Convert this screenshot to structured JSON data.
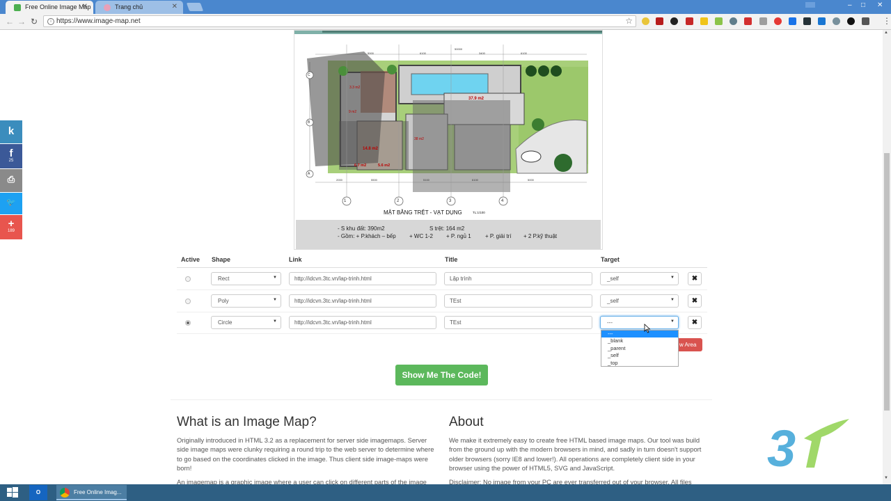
{
  "browser": {
    "tabs": [
      {
        "label": "Free Online Image Map",
        "active": true
      },
      {
        "label": "Trang chủ",
        "active": false
      }
    ],
    "url": "https://www.image-map.net",
    "window_controls": [
      "‒",
      "□",
      "✕"
    ]
  },
  "social": [
    {
      "icon": "k-icon",
      "glyph": "k",
      "count": "",
      "color": "#3b8dbd"
    },
    {
      "icon": "facebook-icon",
      "glyph": "f",
      "count": "25",
      "color": "#3b5998"
    },
    {
      "icon": "print-icon",
      "glyph": "⎙",
      "count": "",
      "color": "#8a8a8a"
    },
    {
      "icon": "twitter-icon",
      "glyph": "🐦",
      "count": "",
      "color": "#1da1f2"
    },
    {
      "icon": "plus-icon",
      "glyph": "+",
      "count": "189",
      "color": "#e8554e"
    }
  ],
  "plan": {
    "title": "MẶT BẰNG TRỆT - VẠT DỤNG",
    "scale": "TL:1/100",
    "notes": [
      "- S khu đất: 390m2",
      "S trệt: 164 m2",
      "- Gồm: + P.khách – bếp",
      "+ WC 1-2",
      "+ P. ngủ 1",
      "+ P. giải trí",
      "+ 2 P.kỹ thuật"
    ],
    "room_labels": [
      "37.9 m2",
      "14.8 m2",
      "6.7 m2",
      "5.6 m2",
      "38 m2",
      "3.3 m2",
      "9 m2"
    ],
    "axis_labels": [
      "1",
      "2",
      "3",
      "4",
      "A",
      "B",
      "C"
    ],
    "dims_top": [
      "5000",
      "6100",
      "50000",
      "3400",
      "6100"
    ],
    "dims_bottom": [
      "2000",
      "5500",
      "5100",
      "6100",
      "5000"
    ]
  },
  "table": {
    "headers": {
      "active": "Active",
      "shape": "Shape",
      "link": "Link",
      "title": "Title",
      "target": "Target"
    },
    "rows": [
      {
        "active": false,
        "shape": "Rect",
        "link": "http://idcvn.3tc.vn/lap-trinh.html",
        "title": "Lập trình",
        "target": "_self"
      },
      {
        "active": false,
        "shape": "Poly",
        "link": "http://idcvn.3tc.vn/lap-trinh.html",
        "title": "TEst",
        "target": "_self"
      },
      {
        "active": true,
        "shape": "Circle",
        "link": "http://idcvn.3tc.vn/lap-trinh.html",
        "title": "TEst",
        "target": "---"
      }
    ],
    "delete_glyph": "✖",
    "target_options": [
      "---",
      "_blank",
      "_parent",
      "_self",
      "_top"
    ],
    "highlighted_option": "---",
    "new_area_fragment": "w Area"
  },
  "show_code_label": "Show Me The Code!",
  "sections": {
    "what": {
      "heading": "What is an Image Map?",
      "p1": "Originally introduced in HTML 3.2 as a replacement for server side imagemaps. Server side image maps were clunky requiring a round trip to the web server to determine where to go based on the coordinates clicked in the image. Thus client side image-maps were born!",
      "p2": "An imagemap is a graphic image where a user can click on different parts of the image"
    },
    "about": {
      "heading": "About",
      "p1": "We make it extremely easy to create free HTML based image maps. Our tool was build from the ground up with the modern browsers in mind, and sadly in turn doesn't support older browsers (sorry IE8 and lower!). All operations are completely client side in your browser using the power of HTML5, SVG and JavaScript.",
      "p2": "Disclaimer: No image from your PC are ever transferred out of your browser. All files"
    }
  },
  "logo_text": "3T",
  "taskbar": {
    "active_window": "Free Online Imag...",
    "outlook_label": "O"
  },
  "colors": {
    "tabbar": "#4a87ce",
    "success": "#5cb85c",
    "danger": "#d9534f",
    "highlight": "#1e90ff",
    "taskbar": "#2e5f83"
  }
}
